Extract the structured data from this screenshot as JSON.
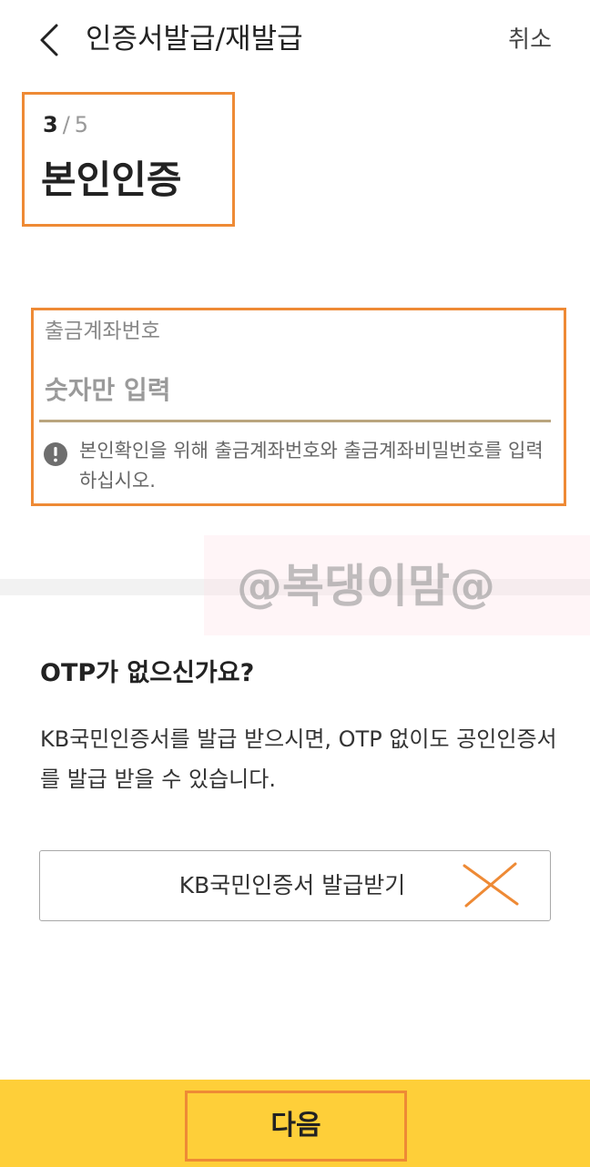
{
  "header": {
    "title": "인증서발급/재발급",
    "cancel_label": "취소",
    "back_icon": "chevron-left-icon"
  },
  "step": {
    "current": "3",
    "separator": "/",
    "total": "5",
    "title": "본인인증"
  },
  "account": {
    "label": "출금계좌번호",
    "placeholder": "숫자만 입력",
    "value": "",
    "notice_icon": "exclamation-circle-icon",
    "notice_text": "본인확인을 위해 출금계좌번호와 출금계좌비밀번호를 입력하십시오."
  },
  "watermark": "@복댕이맘@",
  "otp": {
    "title": "OTP가 없으신가요?",
    "description": "KB국민인증서를 발급 받으시면, OTP 없이도 공인인증서를 발급 받을 수 있습니다.",
    "button_label": "KB국민인증서 발급받기"
  },
  "footer": {
    "next_label": "다음"
  },
  "colors": {
    "accent_yellow": "#fecf39",
    "highlight_orange": "#ee8a35",
    "underline_gold": "#b9a57e"
  }
}
